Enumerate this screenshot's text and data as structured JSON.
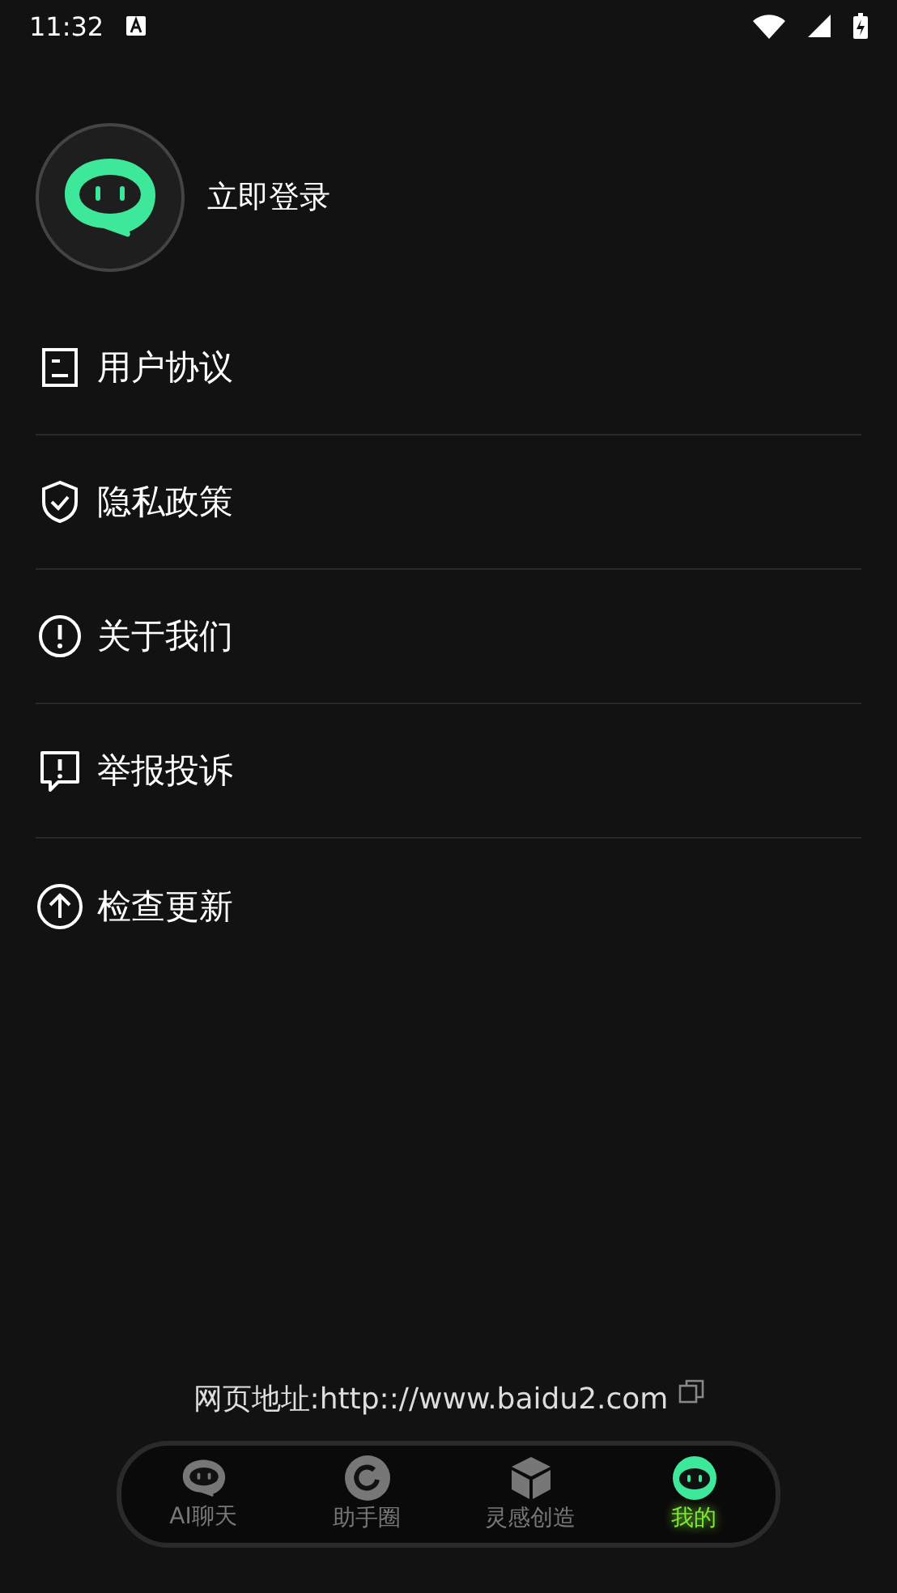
{
  "status_bar": {
    "time": "11:32"
  },
  "profile": {
    "login_label": "立即登录"
  },
  "menu": [
    {
      "label": "用户协议",
      "kind": "document"
    },
    {
      "label": "隐私政策",
      "kind": "shield"
    },
    {
      "label": "关于我们",
      "kind": "info"
    },
    {
      "label": "举报投诉",
      "kind": "report"
    },
    {
      "label": "检查更新",
      "kind": "update"
    }
  ],
  "footer": {
    "web_address": "网页地址:http:://www.baidu2.com"
  },
  "nav": [
    {
      "label": "AI聊天",
      "kind": "chat",
      "selected": false
    },
    {
      "label": "助手圈",
      "kind": "circle",
      "selected": false
    },
    {
      "label": "灵感创造",
      "kind": "cube",
      "selected": false
    },
    {
      "label": "我的",
      "kind": "robot",
      "selected": true
    }
  ]
}
